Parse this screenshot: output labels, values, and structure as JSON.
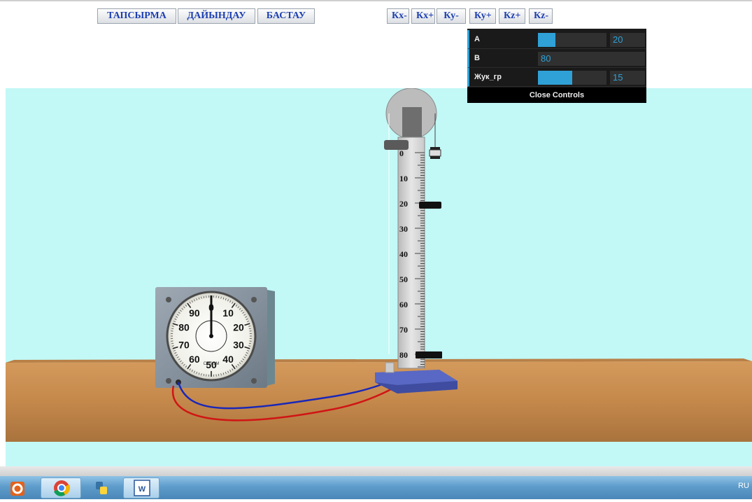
{
  "toolbar": {
    "task_label": "ТАПСЫРМА",
    "prepare_label": "ДАЙЫНДАУ",
    "start_label": "БАСТАУ"
  },
  "camera_buttons": [
    "Кх-",
    "Кх+",
    "Ку-",
    "Ку+",
    "Кz+",
    "Кz-"
  ],
  "controls": {
    "a": {
      "label": "A",
      "value": "20",
      "fraction": 0.26
    },
    "b": {
      "label": "B",
      "value": "80"
    },
    "load": {
      "label": "Жук_гр",
      "value": "15",
      "fraction": 0.5
    },
    "close_label": "Close Controls"
  },
  "stopwatch": {
    "outer_numbers": [
      "0",
      "10",
      "20",
      "30",
      "40",
      "50",
      "60",
      "70",
      "80",
      "90"
    ],
    "brand": "СЭЛ-1М"
  },
  "scale": {
    "marks": [
      "0",
      "10",
      "20",
      "30",
      "40",
      "50",
      "60",
      "70",
      "80"
    ]
  },
  "colors": {
    "sky": "#c2f8f6",
    "table": "#c98a4b",
    "gui_accent": "#2fa1d6",
    "button_text": "#1d3fb0",
    "wire_blue": "#1a28b8",
    "wire_red": "#d01515",
    "base": "#5968c4"
  },
  "taskbar": {
    "items": [
      "opera-icon",
      "chrome-icon",
      "python-icon",
      "word-icon"
    ],
    "language": "RU"
  }
}
